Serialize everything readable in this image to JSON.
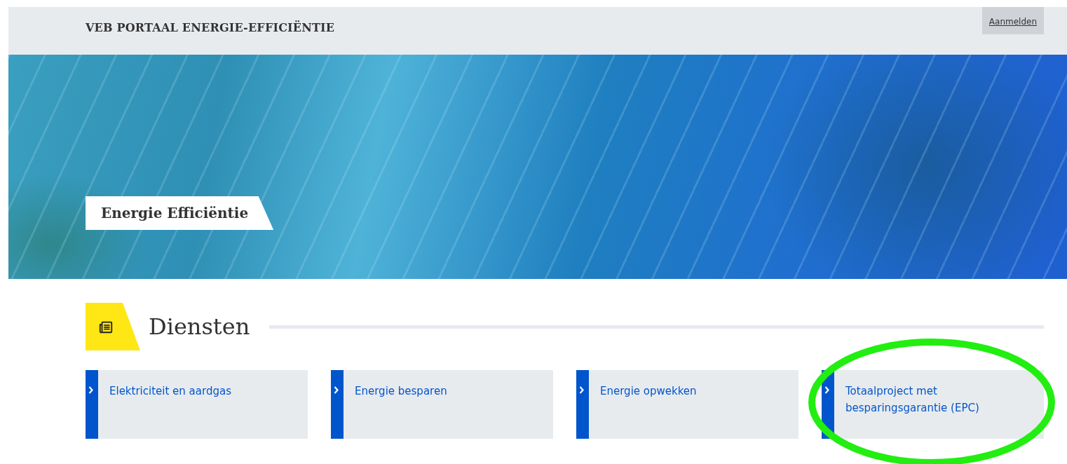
{
  "header": {
    "title": "VEB PORTAAL ENERGIE-EFFICIËNTIE",
    "login": "Aanmelden"
  },
  "hero": {
    "label": "Energie Efficiëntie"
  },
  "section": {
    "title": "Diensten"
  },
  "cards": [
    {
      "label": "Elektriciteit en aardgas",
      "circled": false
    },
    {
      "label": "Energie besparen",
      "circled": false
    },
    {
      "label": "Energie opwekken",
      "circled": false
    },
    {
      "label": "Totaalproject met besparingsgarantie (EPC)",
      "circled": true
    }
  ]
}
